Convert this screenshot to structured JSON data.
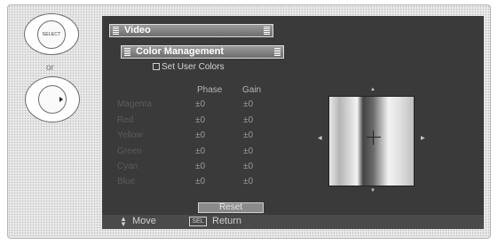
{
  "remote": {
    "select_button_label": "SELECT",
    "or_label": "or"
  },
  "menu": {
    "title": "Video",
    "submenu_title": "Color Management",
    "set_user_colors_label": "Set User Colors",
    "column_headers": {
      "phase": "Phase",
      "gain": "Gain"
    },
    "colors": [
      {
        "name": "Magenta",
        "phase": "±0",
        "gain": "±0"
      },
      {
        "name": "Red",
        "phase": "±0",
        "gain": "±0"
      },
      {
        "name": "Yellow",
        "phase": "±0",
        "gain": "±0"
      },
      {
        "name": "Green",
        "phase": "±0",
        "gain": "±0"
      },
      {
        "name": "Cyan",
        "phase": "±0",
        "gain": "±0"
      },
      {
        "name": "Blue",
        "phase": "±0",
        "gain": "±0"
      }
    ],
    "reset_label": "Reset"
  },
  "footer": {
    "move_label": "Move",
    "sel_key_label": "SEL",
    "return_label": "Return"
  }
}
